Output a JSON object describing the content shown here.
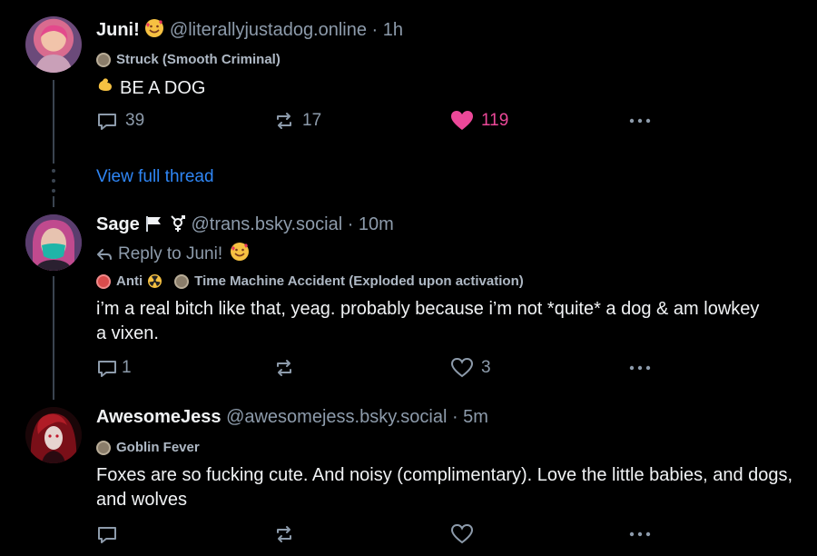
{
  "posts": [
    {
      "name": "Juni!",
      "handle": "@literallyjustadog.online · 1h",
      "badges": [
        {
          "label": "Struck (Smooth Criminal)",
          "color": "#8a7d6a"
        }
      ],
      "text": "BE A DOG",
      "replies": "39",
      "reposts": "17",
      "likes": "119"
    },
    {
      "name": "Sage",
      "handle": "@trans.bsky.social · 10m",
      "reply_to": "Reply to Juni!",
      "badges": [
        {
          "label": "Anti",
          "color": "#d94c4c"
        },
        {
          "label": "Time Machine Accident (Exploded upon activation)",
          "color": "#8a7d6a"
        }
      ],
      "text": "i’m a real bitch like that, yeag. probably because i’m not *quite* a dog & am lowkey a vixen.",
      "replies": "1",
      "reposts": "",
      "likes": "3"
    },
    {
      "name": "AwesomeJess",
      "handle": "@awesomejess.bsky.social · 5m",
      "badges": [
        {
          "label": "Goblin Fever",
          "color": "#8a7d6a"
        }
      ],
      "text": "Foxes are so fucking cute. And noisy (complimentary). Love the little babies, and dogs, and wolves",
      "replies": "",
      "reposts": "",
      "likes": ""
    }
  ],
  "view_full_thread": "View full thread",
  "colors": {
    "accent": "#2f86f5",
    "like": "#ec4899",
    "muted": "#8d9bab"
  }
}
